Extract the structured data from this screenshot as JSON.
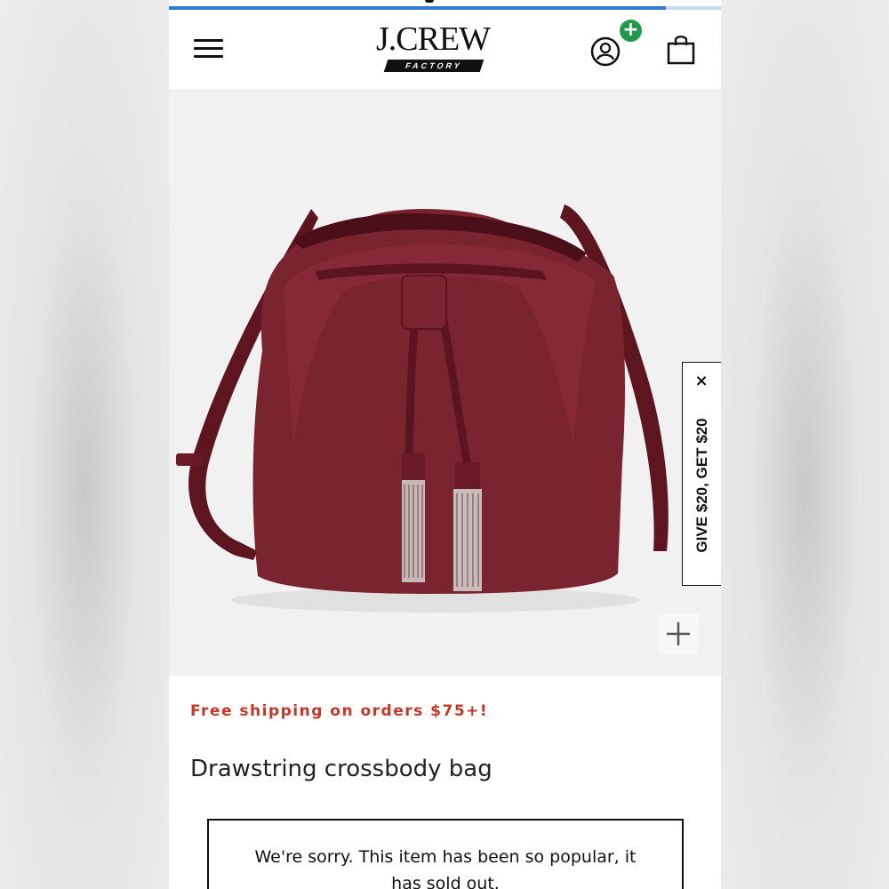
{
  "brand": {
    "name": "J.CREW",
    "sub": "FACTORY"
  },
  "header": {
    "menu_icon": "hamburger-menu-icon",
    "account_icon": "user-account-icon",
    "account_badge": "+",
    "bag_icon": "shopping-bag-icon"
  },
  "page_load_progress": 0.9,
  "product": {
    "image_desc": "burgundy-drawstring-bucket-bag",
    "color": "#7a2430",
    "zoom_label": "+",
    "shipping_promo": "Free shipping on orders $75+!",
    "title": "Drawstring crossbody bag",
    "soldout_message": "We're sorry. This item has been so popular, it has sold out."
  },
  "promo_tab": {
    "label": "GIVE $20, GET $20",
    "close_label": "×"
  },
  "colors": {
    "promo_red": "#c0392b",
    "badge_green": "#1f9a4a",
    "progress_blue": "#2f7ad3"
  }
}
